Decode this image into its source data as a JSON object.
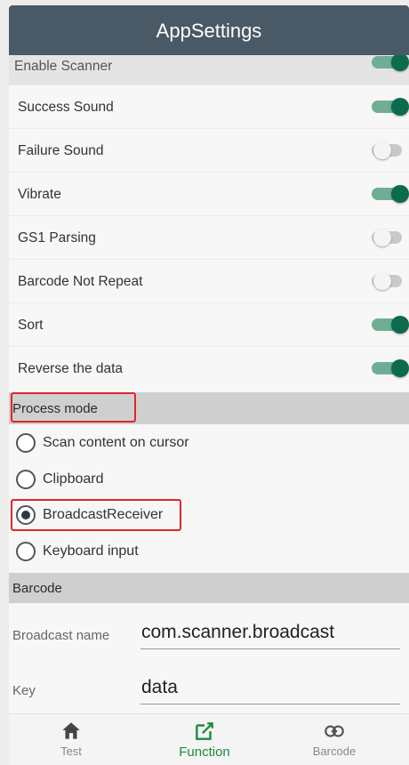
{
  "app": {
    "title": "AppSettings"
  },
  "switches": [
    {
      "label": "Enable Scanner",
      "on": true
    },
    {
      "label": "Success Sound",
      "on": true
    },
    {
      "label": "Failure Sound",
      "on": false
    },
    {
      "label": "Vibrate",
      "on": true
    },
    {
      "label": "GS1 Parsing",
      "on": false
    },
    {
      "label": "Barcode Not Repeat",
      "on": false
    },
    {
      "label": "Sort",
      "on": true
    },
    {
      "label": "Reverse the data",
      "on": true
    }
  ],
  "process_mode": {
    "header": "Process mode",
    "options": [
      {
        "label": "Scan content on cursor",
        "checked": false
      },
      {
        "label": "Clipboard",
        "checked": false
      },
      {
        "label": "BroadcastReceiver",
        "checked": true
      },
      {
        "label": "Keyboard input",
        "checked": false
      }
    ]
  },
  "barcode": {
    "header": "Barcode",
    "broadcast_name": {
      "label": "Broadcast name",
      "value": "com.scanner.broadcast"
    },
    "key": {
      "label": "Key",
      "value": "data"
    }
  },
  "bottom_nav": [
    {
      "label": "Test",
      "icon": "home-icon",
      "active": false
    },
    {
      "label": "Function",
      "icon": "edit-icon",
      "active": true
    },
    {
      "label": "Barcode",
      "icon": "link-icon",
      "active": false
    }
  ],
  "colors": {
    "app_bar": "#4a5966",
    "switch_on": "#0b6b4c",
    "nav_active": "#1e8a3c",
    "highlight": "#e0262b"
  }
}
